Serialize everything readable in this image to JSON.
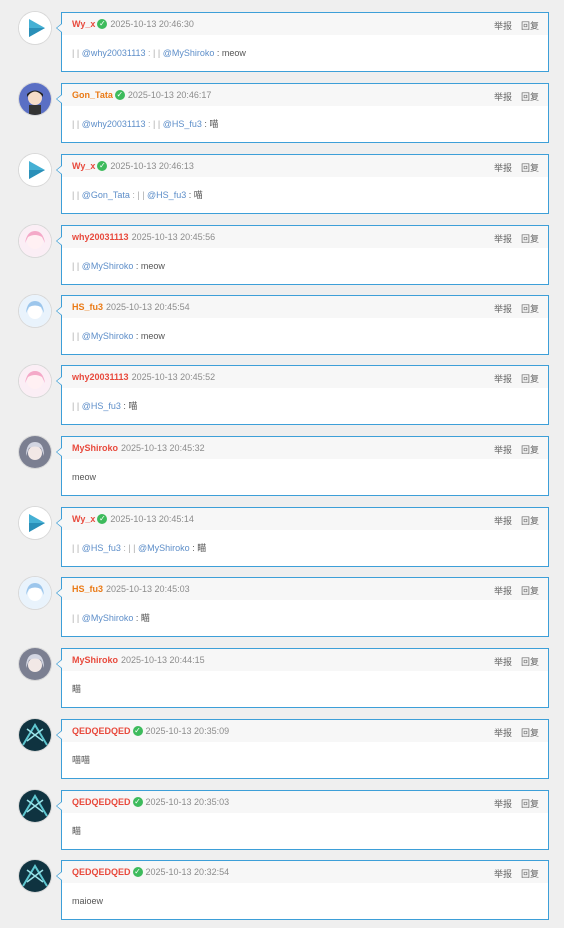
{
  "actions": {
    "report": "举报",
    "reply": "回复"
  },
  "comments": [
    {
      "user": "Wy_x",
      "color": "red",
      "verified": true,
      "avatar": "play-avatar",
      "time": "2025-10-13 20:46:30",
      "parts": [
        {
          "t": "sep",
          "v": "| | "
        },
        {
          "t": "m",
          "v": "@why20031113"
        },
        {
          "t": "sep",
          "v": " : | | "
        },
        {
          "t": "m",
          "v": "@MyShiroko"
        },
        {
          "t": "x",
          "v": " : meow"
        }
      ]
    },
    {
      "user": "Gon_Tata",
      "color": "orange",
      "verified": true,
      "avatar": "boy-avatar",
      "time": "2025-10-13 20:46:17",
      "parts": [
        {
          "t": "sep",
          "v": "| | "
        },
        {
          "t": "m",
          "v": "@why20031113"
        },
        {
          "t": "sep",
          "v": " : | | "
        },
        {
          "t": "m",
          "v": "@HS_fu3"
        },
        {
          "t": "x",
          "v": " : 喵"
        }
      ]
    },
    {
      "user": "Wy_x",
      "color": "red",
      "verified": true,
      "avatar": "play-avatar",
      "time": "2025-10-13 20:46:13",
      "parts": [
        {
          "t": "sep",
          "v": "| | "
        },
        {
          "t": "m",
          "v": "@Gon_Tata"
        },
        {
          "t": "sep",
          "v": " : | | "
        },
        {
          "t": "m",
          "v": "@HS_fu3"
        },
        {
          "t": "x",
          "v": " : 喵"
        }
      ]
    },
    {
      "user": "why20031113",
      "color": "red",
      "verified": false,
      "avatar": "pink-anime-avatar",
      "time": "2025-10-13 20:45:56",
      "parts": [
        {
          "t": "sep",
          "v": "| | "
        },
        {
          "t": "m",
          "v": "@MyShiroko"
        },
        {
          "t": "x",
          "v": " : meow"
        }
      ]
    },
    {
      "user": "HS_fu3",
      "color": "orange",
      "verified": false,
      "avatar": "blue-anime-avatar",
      "time": "2025-10-13 20:45:54",
      "parts": [
        {
          "t": "sep",
          "v": "| | "
        },
        {
          "t": "m",
          "v": "@MyShiroko"
        },
        {
          "t": "x",
          "v": " : meow"
        }
      ]
    },
    {
      "user": "why20031113",
      "color": "red",
      "verified": false,
      "avatar": "pink-anime-avatar",
      "time": "2025-10-13 20:45:52",
      "parts": [
        {
          "t": "sep",
          "v": "| | "
        },
        {
          "t": "m",
          "v": "@HS_fu3"
        },
        {
          "t": "x",
          "v": " : 喵"
        }
      ]
    },
    {
      "user": "MyShiroko",
      "color": "red",
      "verified": false,
      "avatar": "silver-hair-avatar",
      "time": "2025-10-13 20:45:32",
      "parts": [
        {
          "t": "x",
          "v": "meow"
        }
      ]
    },
    {
      "user": "Wy_x",
      "color": "red",
      "verified": true,
      "avatar": "play-avatar",
      "time": "2025-10-13 20:45:14",
      "parts": [
        {
          "t": "sep",
          "v": "| | "
        },
        {
          "t": "m",
          "v": "@HS_fu3"
        },
        {
          "t": "sep",
          "v": " : | | "
        },
        {
          "t": "m",
          "v": "@MyShiroko"
        },
        {
          "t": "x",
          "v": " : 瞄"
        }
      ]
    },
    {
      "user": "HS_fu3",
      "color": "orange",
      "verified": false,
      "avatar": "blue-anime-avatar",
      "time": "2025-10-13 20:45:03",
      "parts": [
        {
          "t": "sep",
          "v": "| | "
        },
        {
          "t": "m",
          "v": "@MyShiroko"
        },
        {
          "t": "x",
          "v": " : 瞄"
        }
      ]
    },
    {
      "user": "MyShiroko",
      "color": "red",
      "verified": false,
      "avatar": "silver-hair-avatar",
      "time": "2025-10-13 20:44:15",
      "parts": [
        {
          "t": "x",
          "v": "瞄"
        }
      ]
    },
    {
      "user": "QEDQEDQED",
      "color": "red",
      "verified": true,
      "avatar": "teal-abstract-avatar",
      "time": "2025-10-13 20:35:09",
      "parts": [
        {
          "t": "x",
          "v": "喵喵"
        }
      ]
    },
    {
      "user": "QEDQEDQED",
      "color": "red",
      "verified": true,
      "avatar": "teal-abstract-avatar",
      "time": "2025-10-13 20:35:03",
      "parts": [
        {
          "t": "x",
          "v": "瞄"
        }
      ]
    },
    {
      "user": "QEDQEDQED",
      "color": "red",
      "verified": true,
      "avatar": "teal-abstract-avatar",
      "time": "2025-10-13 20:32:54",
      "parts": [
        {
          "t": "x",
          "v": "maioew"
        }
      ]
    }
  ]
}
